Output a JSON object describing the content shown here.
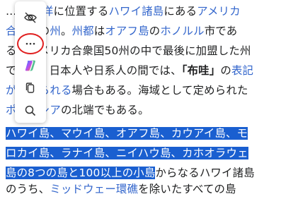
{
  "article": {
    "lines": [
      {
        "segments": [
          {
            "t": "… ",
            "link": false
          },
          {
            "t": "太平洋",
            "link": true
          },
          {
            "t": "に位置する",
            "link": false
          },
          {
            "t": "ハワイ諸島",
            "link": true
          },
          {
            "t": "にある",
            "link": false
          },
          {
            "t": "アメリカ",
            "link": true
          }
        ]
      },
      {
        "segments": [
          {
            "t": "合衆国",
            "link": true
          },
          {
            "t": "の",
            "link": false
          },
          {
            "t": "州",
            "link": true
          },
          {
            "t": "。",
            "link": false
          },
          {
            "t": "州都",
            "link": true
          },
          {
            "t": "は",
            "link": false
          },
          {
            "t": "オアフ島",
            "link": true
          },
          {
            "t": "の",
            "link": false
          },
          {
            "t": "ホノルル",
            "link": true
          },
          {
            "t": "市であ",
            "link": false
          }
        ]
      },
      {
        "segments": [
          {
            "t": "る。アメリカ合衆国50州の中で最後に加盟した州",
            "link": false
          }
        ]
      },
      {
        "segments": [
          {
            "t": "であり、日本人や日系人の間では、",
            "link": false
          },
          {
            "t": "「布哇」",
            "link": false,
            "bold": true
          },
          {
            "t": "の",
            "link": false
          },
          {
            "t": "表記",
            "link": true
          }
        ]
      },
      {
        "segments": [
          {
            "t": "が用いられる",
            "link": true
          },
          {
            "t": "場合もある。海域として定められた",
            "link": false
          }
        ]
      },
      {
        "segments": [
          {
            "t": "ポリネシア",
            "link": true
          },
          {
            "t": "の北端でもある。",
            "link": false
          }
        ]
      }
    ],
    "selected_lines": [
      "ハワイ島、マウイ島、オアフ島、カウアイ島、モ",
      "ロカイ島、ラナイ島、ニイハウ島、カホオラウェ",
      "島の8つの島と100以上の小島"
    ],
    "after_selection": "からなるハワイ諸島",
    "last_line": [
      {
        "t": "のうち、",
        "link": false
      },
      {
        "t": "ミッドウェー環礁",
        "link": true
      },
      {
        "t": "を除いたすべての島",
        "link": false
      }
    ]
  },
  "toolbar": {
    "buttons": [
      {
        "name": "hide-toolbar-button",
        "icon": "eye-off-icon"
      },
      {
        "name": "more-options-button",
        "icon": "more-horizontal-icon"
      },
      {
        "name": "copilot-button",
        "icon": "copilot-icon"
      },
      {
        "name": "copy-button",
        "icon": "copy-icon"
      },
      {
        "name": "search-button",
        "icon": "search-icon"
      }
    ]
  },
  "colors": {
    "link": "#3366cc",
    "selection": "#1a5fd0",
    "highlight_ring": "#e02020"
  }
}
